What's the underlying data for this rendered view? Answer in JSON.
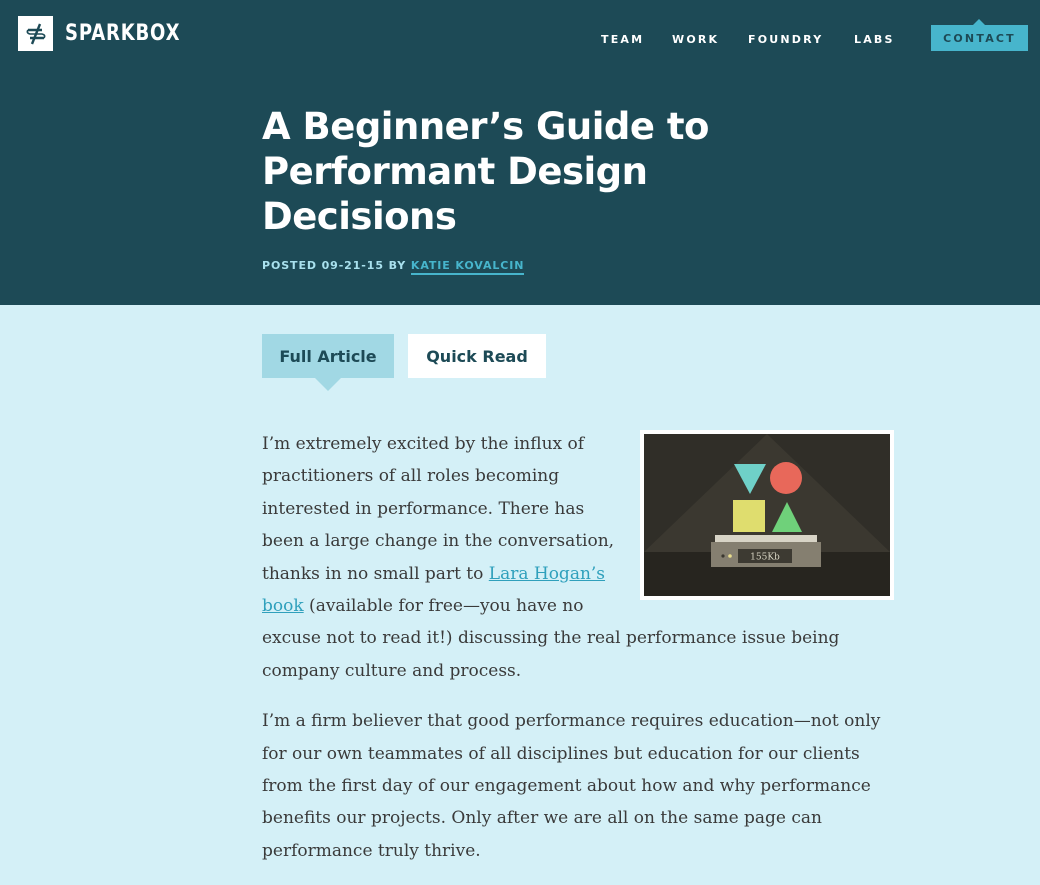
{
  "brand": {
    "name": "SPARKBOX",
    "logo_icon": "sparkbox-logo-icon"
  },
  "nav": {
    "items": [
      {
        "label": "TEAM"
      },
      {
        "label": "WORK"
      },
      {
        "label": "FOUNDRY"
      },
      {
        "label": "LABS"
      }
    ],
    "contact_label": "CONTACT"
  },
  "article_header": {
    "title": "A Beginner’s Guide to Performant Design Decisions",
    "posted_prefix": "POSTED 09-21-15 BY",
    "author": "KATIE KOVALCIN"
  },
  "tabs": [
    {
      "label": "Full Article",
      "active": true
    },
    {
      "label": "Quick Read",
      "active": false
    }
  ],
  "figure": {
    "icon": "performance-scale-illustration",
    "scale_readout": "155Kb"
  },
  "body": {
    "p1_before_link": "I’m extremely excited by the influx of practitioners of all roles becoming interested in performance. There has been a large change in the conversation, thanks in no small part to ",
    "p1_link": "Lara Hogan’s book",
    "p1_after_link": " (available for free—you have no excuse not to read it!) discussing the real performance issue being company culture and process.",
    "p2": "I’m a firm believer that good performance requires education—not only for our own teammates of all disciplines but education for our clients from the first day of our engagement about how and why performance benefits our projects. Only after we are all on the same page can performance truly thrive."
  },
  "colors": {
    "header_bg": "#1d4a56",
    "page_bg": "#d4f0f7",
    "accent": "#47b5cc",
    "tab_active": "#a1d8e4"
  }
}
